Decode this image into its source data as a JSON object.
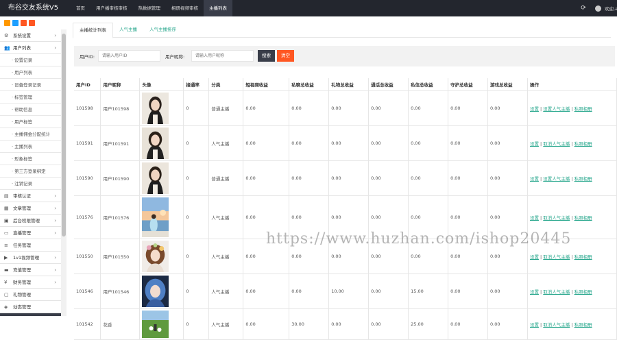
{
  "header": {
    "brand": "布谷交友系统V5",
    "nav": [
      "首页",
      "用户播审核审核",
      "热数据管理",
      "相册视频审核",
      "主播列表"
    ],
    "active_index": 4,
    "user_label": "欢迎,admin"
  },
  "sidebar": {
    "menu_top": [
      {
        "label": "系统设置",
        "icon": "gear-icon"
      },
      {
        "label": "用户列表",
        "icon": "users-icon"
      }
    ],
    "submenu": [
      "设置记录",
      "用户列表",
      "设备登录记录",
      "标签管理",
      "帮助信息",
      "用户标签",
      "主播佣金分配统计",
      "主播列表",
      "形象标签",
      "第三方登录绑定",
      "注销记录"
    ],
    "menu_bottom": [
      {
        "label": "审核认证",
        "icon": "id-card-icon"
      },
      {
        "label": "文章管理",
        "icon": "grid-icon"
      },
      {
        "label": "后台权限管理",
        "icon": "folder-icon"
      },
      {
        "label": "直播管理",
        "icon": "tv-icon"
      },
      {
        "label": "任务管理",
        "icon": "list-icon"
      },
      {
        "label": "1v1视频管理",
        "icon": "video-icon"
      },
      {
        "label": "充值管理",
        "icon": "card-icon"
      },
      {
        "label": "财务管理",
        "icon": "yen-icon"
      },
      {
        "label": "礼物管理",
        "icon": "gift-icon"
      },
      {
        "label": "动态管理",
        "icon": "feed-icon"
      }
    ],
    "toolbar_colors": [
      "#ff9800",
      "#1e9fff",
      "#ff5722",
      "#ff5722"
    ]
  },
  "tabs": [
    "主播统计列表",
    "人气主播",
    "人气主播排序"
  ],
  "filter": {
    "uid_label": "用户ID:",
    "uid_placeholder": "请输入用户ID",
    "name_label": "用户昵称:",
    "name_placeholder": "请输入用户昵称",
    "search": "搜索",
    "reset": "清空"
  },
  "table": {
    "headers": [
      "用户ID",
      "用户昵称",
      "头像",
      "接通率",
      "分类",
      "短视频收益",
      "私聊总收益",
      "礼物总收益",
      "通话总收益",
      "私信总收益",
      "守护总收益",
      "游戏总收益",
      "操作"
    ],
    "rows": [
      {
        "id": "101598",
        "name": "用户101598",
        "avatar": "avatar-girl-1",
        "rate": "0",
        "category": "普通主播",
        "vals": [
          "0.00",
          "0.00",
          "0.00",
          "0.00",
          "0.00",
          "0.00",
          "0.00"
        ],
        "ops": [
          "设置",
          "设置人气主播",
          "私照相册"
        ]
      },
      {
        "id": "101591",
        "name": "用户101591",
        "avatar": "avatar-girl-2",
        "rate": "0",
        "category": "人气主播",
        "vals": [
          "0.00",
          "0.00",
          "0.00",
          "0.00",
          "0.00",
          "0.00",
          "0.00"
        ],
        "ops": [
          "设置",
          "取消人气主播",
          "私照相册"
        ]
      },
      {
        "id": "101590",
        "name": "用户101590",
        "avatar": "avatar-girl-3",
        "rate": "0",
        "category": "普通主播",
        "vals": [
          "0.00",
          "0.00",
          "0.00",
          "0.00",
          "0.00",
          "0.00",
          "0.00"
        ],
        "ops": [
          "设置",
          "设置人气主播",
          "私照相册"
        ]
      },
      {
        "id": "101576",
        "name": "用户101576",
        "avatar": "avatar-seaside",
        "rate": "0",
        "category": "人气主播",
        "vals": [
          "0.00",
          "0.00",
          "0.00",
          "0.00",
          "0.00",
          "0.00",
          "0.00"
        ],
        "ops": [
          "设置",
          "取消人气主播",
          "私照相册"
        ]
      },
      {
        "id": "101550",
        "name": "用户101550",
        "avatar": "avatar-flower",
        "rate": "0",
        "category": "人气主播",
        "vals": [
          "0.00",
          "0.00",
          "0.00",
          "0.00",
          "0.00",
          "0.00",
          "0.00"
        ],
        "ops": [
          "设置",
          "取消人气主播",
          "私照相册"
        ]
      },
      {
        "id": "101546",
        "name": "用户101546",
        "avatar": "avatar-blue-hair",
        "rate": "0",
        "category": "人气主播",
        "vals": [
          "0.00",
          "0.00",
          "10.00",
          "0.00",
          "15.00",
          "0.00",
          "0.00"
        ],
        "ops": [
          "设置",
          "取消人气主播",
          "私照相册"
        ]
      },
      {
        "id": "101542",
        "name": "花香",
        "avatar": "avatar-meadow",
        "rate": "0",
        "category": "人气主播",
        "vals": [
          "0.00",
          "30.00",
          "0.00",
          "0.00",
          "25.00",
          "0.00",
          "0.00"
        ],
        "ops": [
          "设置",
          "取消人气主播",
          "私照相册"
        ]
      }
    ]
  },
  "watermark": "https://www.huzhan.com/ishop20445",
  "colors": {
    "accent": "#2aa88e",
    "topbar": "#23262e",
    "search_btn": "#393d49",
    "reset_btn": "#ff5722"
  }
}
